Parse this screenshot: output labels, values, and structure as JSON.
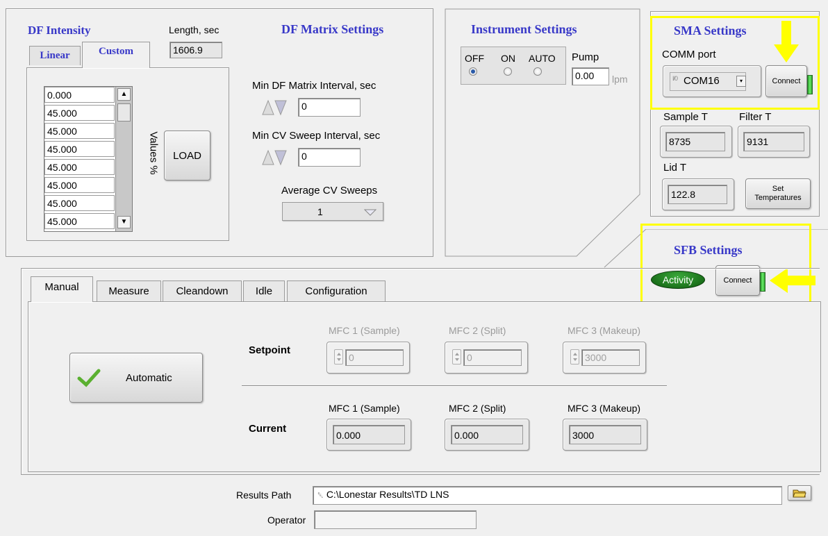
{
  "df_intensity": {
    "title": "DF Intensity",
    "tabs": [
      "Linear",
      "Custom"
    ],
    "active_tab": "Custom",
    "length_label": "Length, sec",
    "length_value": "1606.9",
    "values": [
      "0.000",
      "45.000",
      "45.000",
      "45.000",
      "45.000",
      "45.000",
      "45.000",
      "45.000"
    ],
    "values_label": "Values  %",
    "load_label": "LOAD"
  },
  "df_matrix": {
    "title": "DF Matrix Settings",
    "min_df_label": "Min DF Matrix Interval, sec",
    "min_df_value": "0",
    "min_cv_label": "Min CV Sweep Interval, sec",
    "min_cv_value": "0",
    "avg_cv_label": "Average CV Sweeps",
    "avg_cv_value": "1"
  },
  "instrument": {
    "title": "Instrument Settings",
    "radio_labels": [
      "OFF",
      "ON",
      "AUTO"
    ],
    "selected": "OFF",
    "pump_label": "Pump",
    "pump_value": "0.00",
    "pump_unit": "lpm"
  },
  "sma": {
    "title": "SMA Settings",
    "comm_label": "COMM port",
    "comm_prefix": "I/0",
    "comm_value": "COM16",
    "connect_label": "Connect",
    "sample_t_label": "Sample T",
    "sample_t_value": "8735",
    "filter_t_label": "Filter T",
    "filter_t_value": "9131",
    "lid_t_label": "Lid T",
    "lid_t_value": "122.8",
    "set_temps_line1": "Set",
    "set_temps_line2": "Temperatures"
  },
  "sfb": {
    "title": "SFB Settings",
    "activity_label": "Activity",
    "connect_label": "Connect"
  },
  "main_tabs": [
    "Manual",
    "Measure",
    "Cleandown",
    "Idle",
    "Configuration"
  ],
  "active_main_tab": "Manual",
  "manual": {
    "automatic_label": "Automatic",
    "setpoint_label": "Setpoint",
    "current_label": "Current",
    "mfc_headers": [
      "MFC 1 (Sample)",
      "MFC 2 (Split)",
      "MFC 3 (Makeup)"
    ],
    "setpoint_values": [
      "0",
      "0",
      "3000"
    ],
    "current_values": [
      "0.000",
      "0.000",
      "3000"
    ]
  },
  "footer": {
    "results_path_label": "Results Path",
    "results_path_value": "C:\\Lonestar Results\\TD LNS",
    "operator_label": "Operator",
    "operator_value": ""
  },
  "colors": {
    "title_blue": "#3838c8",
    "highlight_yellow": "#ffff00",
    "led_green": "#3cd03c",
    "activity_green": "#1a7a1a"
  }
}
